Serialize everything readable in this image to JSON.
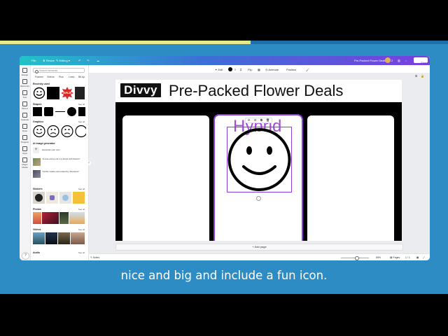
{
  "window": {
    "file_label": "File",
    "resize_label": "Resize",
    "editing_label": "Editing",
    "doc_title": "Pre-Packed Flower Deals",
    "share_label": "Share",
    "avatar_count": "2"
  },
  "rail": {
    "items": [
      {
        "label": "Design",
        "icon": "design-icon"
      },
      {
        "label": "Elements",
        "icon": "elements-icon"
      },
      {
        "label": "Text",
        "icon": "text-icon"
      },
      {
        "label": "Brand",
        "icon": "brand-icon"
      },
      {
        "label": "Uploads",
        "icon": "uploads-icon"
      },
      {
        "label": "Draw",
        "icon": "draw-icon"
      },
      {
        "label": "Projects",
        "icon": "projects-icon"
      },
      {
        "label": "Apps",
        "icon": "apps-icon"
      },
      {
        "label": "Magic Media",
        "icon": "magic-media-icon"
      }
    ]
  },
  "panel": {
    "search_placeholder": "Search elements",
    "tabs": [
      "Frames",
      "Videos",
      "Pics",
      "Lines",
      "Bit Ap"
    ],
    "recently_used": "Recently used",
    "shapes": "Shapes",
    "graphics": "Graphics",
    "ai_generator": "AI image generator",
    "generate_own": "Generate your own",
    "prompt1": "\"A cute anime cat in a forest with flowers\"",
    "prompt2": "\"Gothic castle surrounded by dinosaurs\"",
    "stickers": "Stickers",
    "photos": "Photos",
    "videos": "Videos",
    "audio": "Audio",
    "see_all": "See all",
    "sale_text": "SALE"
  },
  "toolbar": {
    "edit": "Edit",
    "flip": "Flip",
    "animate": "Animate",
    "position": "Position"
  },
  "slide": {
    "logo": "Divvy",
    "title": "Pre-Packed Flower Deals",
    "hybrid": "Hybrid"
  },
  "canvas": {
    "add_page": "+ Add page"
  },
  "footer": {
    "notes": "Notes",
    "zoom": "65%",
    "pages": "Pages",
    "page_count": "1 / 1",
    "zoom_level": 0.55
  },
  "caption": "nice and big and include a fun icon.",
  "colors": {
    "background": "#2e8cc4",
    "accent": "#8b3fd6",
    "hybrid_text": "#a04fd4",
    "stripe_yellow": "#e7e88a"
  }
}
